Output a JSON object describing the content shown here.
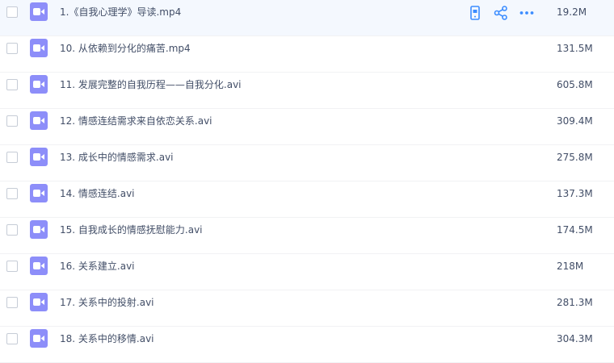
{
  "files": [
    {
      "name": "1.《自我心理学》导读.mp4",
      "size": "19.2M",
      "hovered": true
    },
    {
      "name": "10. 从依赖到分化的痛苦.mp4",
      "size": "131.5M"
    },
    {
      "name": "11. 发展完整的自我历程——自我分化.avi",
      "size": "605.8M"
    },
    {
      "name": "12. 情感连结需求来自依恋关系.avi",
      "size": "309.4M"
    },
    {
      "name": "13. 成长中的情感需求.avi",
      "size": "275.8M"
    },
    {
      "name": "14. 情感连结.avi",
      "size": "137.3M"
    },
    {
      "name": "15. 自我成长的情感抚慰能力.avi",
      "size": "174.5M"
    },
    {
      "name": "16. 关系建立.avi",
      "size": "218M"
    },
    {
      "name": "17. 关系中的投射.avi",
      "size": "281.3M"
    },
    {
      "name": "18. 关系中的移情.avi",
      "size": "304.3M"
    }
  ],
  "row_actions": [
    "phone-icon",
    "share-icon",
    "more-icon"
  ],
  "colors": {
    "accent": "#3b8cff",
    "video_icon": "#8d8ef9",
    "hover_row": "#f4f8fe",
    "text": "#424e67"
  }
}
